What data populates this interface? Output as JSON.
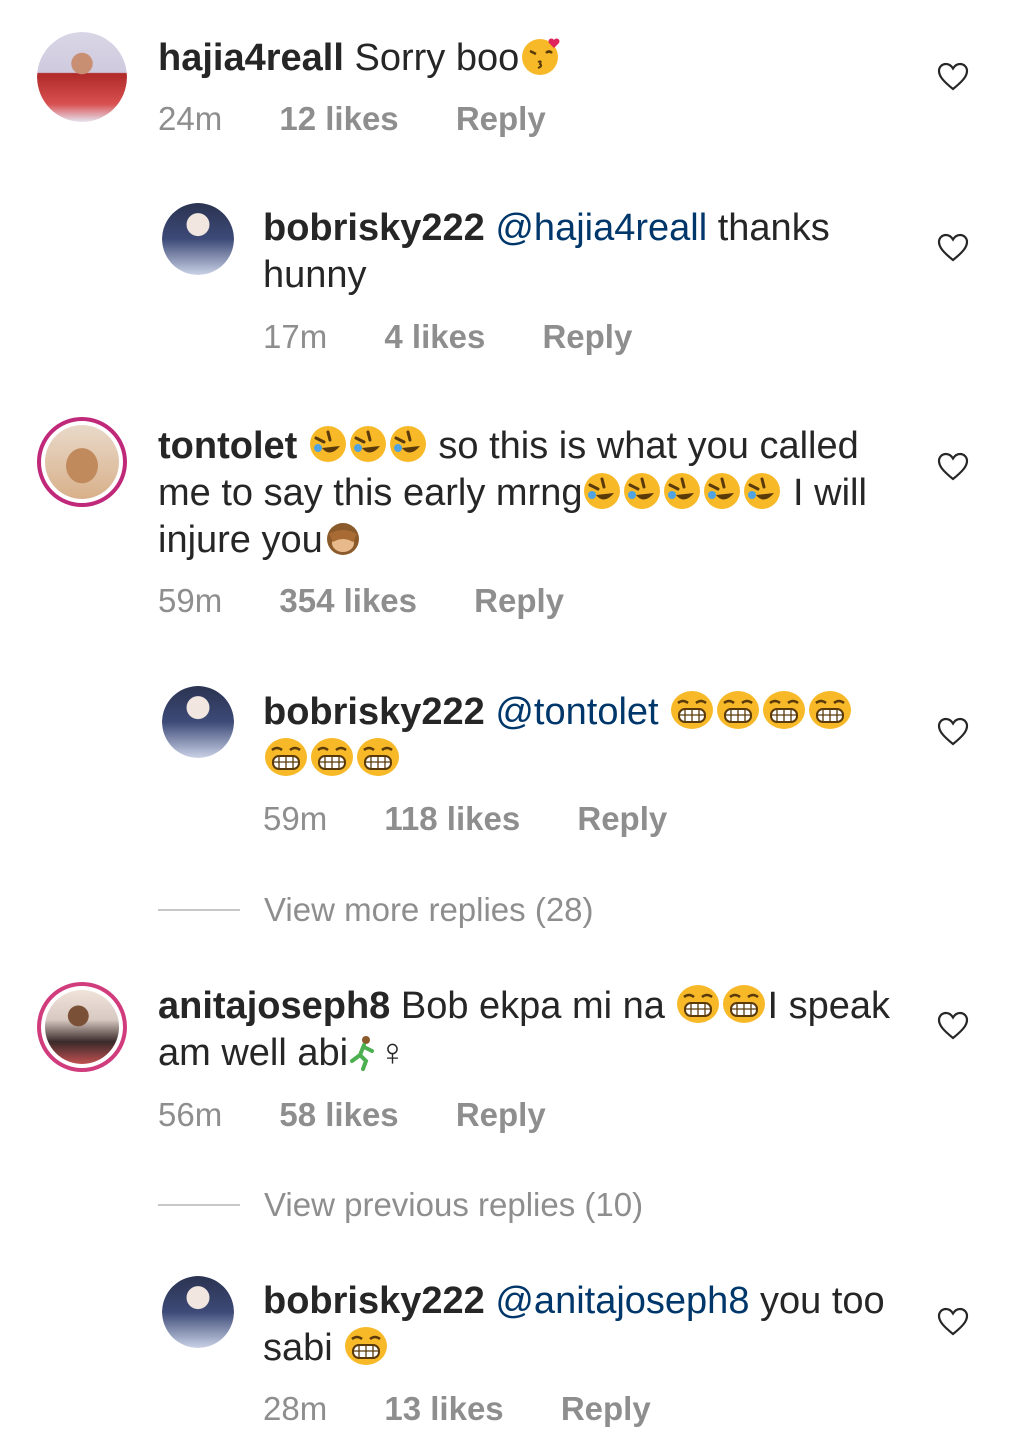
{
  "comments": [
    {
      "user": "hajia4reall",
      "text": "Sorry boo",
      "time": "24m",
      "likes": "12 likes",
      "reply_label": "Reply"
    },
    {
      "user": "bobrisky222",
      "mention": "@hajia4reall",
      "text": "thanks hunny",
      "time": "17m",
      "likes": "4 likes",
      "reply_label": "Reply"
    },
    {
      "user": "tontolet",
      "text_a": "so this is what you called me to say this early mrng",
      "text_b": "I will injure you",
      "time": "59m",
      "likes": "354 likes",
      "reply_label": "Reply"
    },
    {
      "user": "bobrisky222",
      "mention": "@tontolet",
      "time": "59m",
      "likes": "118 likes",
      "reply_label": "Reply"
    },
    {
      "user": "anitajoseph8",
      "text_a": "Bob ekpa mi na",
      "text_b": "I speak am well abi",
      "text_c": "♀",
      "time": "56m",
      "likes": "58 likes",
      "reply_label": "Reply"
    },
    {
      "user": "bobrisky222",
      "mention": "@anitajoseph8",
      "text": "you too sabi",
      "time": "28m",
      "likes": "13 likes",
      "reply_label": "Reply"
    }
  ],
  "view_more_replies": "View more replies (28)",
  "view_previous_replies": "View previous replies (10)",
  "icons": {
    "heart": "heart-outline-icon",
    "kiss": "kissing-face-emoji",
    "rofl": "rolling-on-floor-laughing-emoji",
    "grin": "grinning-squinting-face-emoji",
    "monkey": "see-no-evil-monkey-emoji",
    "runner": "woman-running-emoji"
  },
  "colors": {
    "mention": "#00376b",
    "meta": "#8e8e8e",
    "ring": "#c0287a"
  }
}
